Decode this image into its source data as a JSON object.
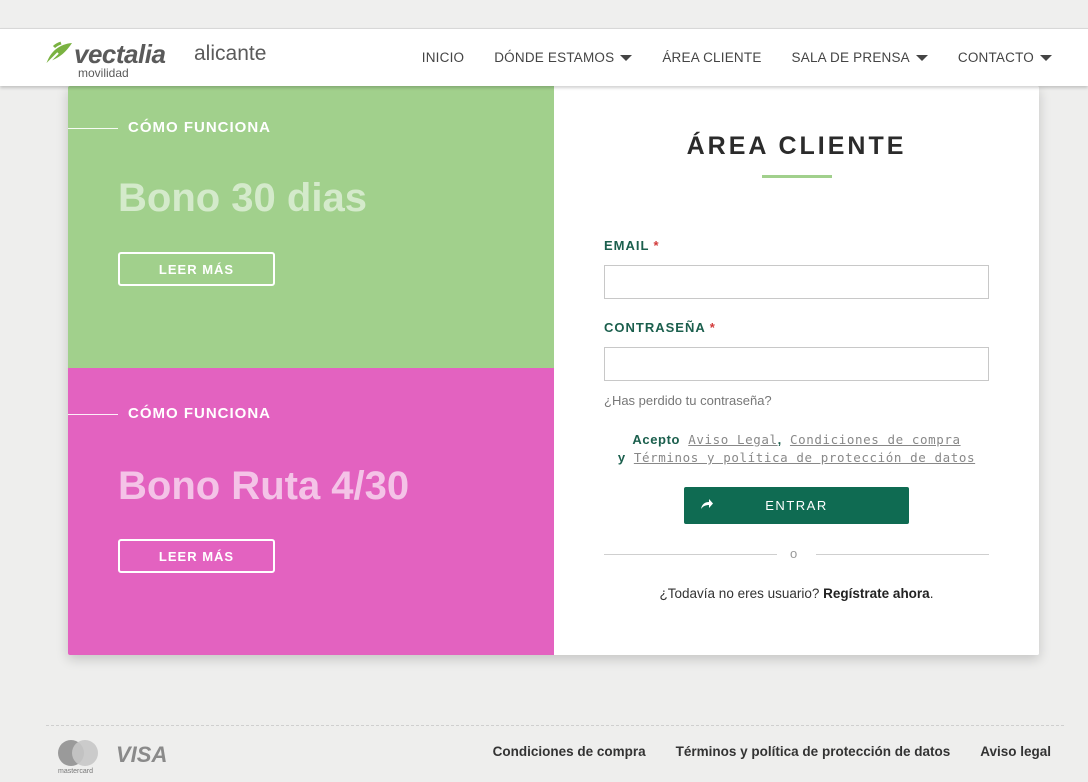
{
  "brand": {
    "word": "vectalia",
    "city": "alicante",
    "sub": "movilidad",
    "accent": "#7ab241"
  },
  "nav": {
    "items": [
      {
        "label": "INICIO",
        "dropdown": false
      },
      {
        "label": "DÓNDE ESTAMOS",
        "dropdown": true
      },
      {
        "label": "ÁREA CLIENTE",
        "dropdown": false
      },
      {
        "label": "SALA DE PRENSA",
        "dropdown": true
      },
      {
        "label": "CONTACTO",
        "dropdown": true
      }
    ]
  },
  "promos": [
    {
      "kicker": "CÓMO FUNCIONA",
      "title": "Bono 30 dias",
      "button": "LEER MÁS",
      "color": "#a1d08c"
    },
    {
      "kicker": "CÓMO FUNCIONA",
      "title": "Bono Ruta 4/30",
      "button": "LEER MÁS",
      "color": "#e362c0"
    }
  ],
  "login": {
    "title": "ÁREA CLIENTE",
    "email_label": "EMAIL",
    "email_value": "",
    "password_label": "CONTRASEÑA",
    "password_value": "",
    "required_mark": "*",
    "forgot": "¿Has perdido tu contraseña?",
    "accept_prefix": "Acepto",
    "legal_link": "Aviso Legal",
    "comma": ",",
    "conditions_link": "Condiciones de compra",
    "and": "y",
    "privacy_link": "Términos y política de protección de datos",
    "submit": "ENTRAR",
    "or": "o",
    "register_text": "¿Todavía no eres usuario?",
    "register_link": "Regístrate ahora",
    "register_end": ".",
    "button_color": "#0f6b52"
  },
  "footer": {
    "mastercard_label": "mastercard",
    "visa_label": "VISA",
    "links": [
      "Condiciones de compra",
      "Términos y política de protección de datos",
      "Aviso legal"
    ]
  }
}
